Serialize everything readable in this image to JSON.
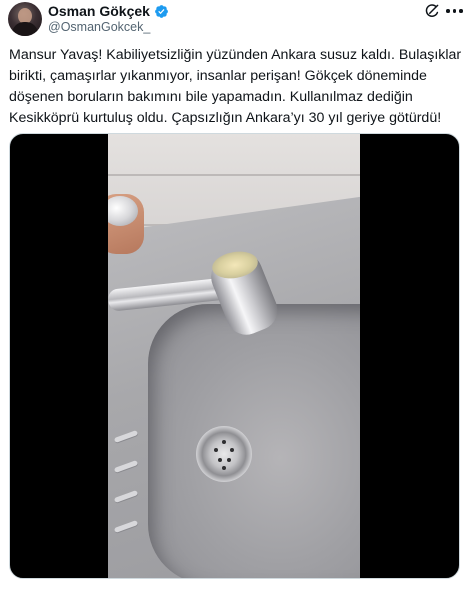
{
  "author": {
    "display_name": "Osman Gökçek",
    "handle": "@OsmanGokcek_",
    "verified_color": "#1d9bf0"
  },
  "actions": {
    "grok_icon": "grok-icon",
    "more_icon": "more-icon"
  },
  "tweet": {
    "text": "Mansur Yavaş! Kabiliyetsizliğin yüzünden Ankara susuz kaldı. Bulaşıklar birikti, çamaşırlar yıkanmıyor, insanlar perişan! Gökçek döneminde döşenen boruların bakımını bile yapamadın. Kullanılmaz dediğin Kesikköprü kurtuluş oldu. Çapsızlığın Ankara’yı 30 yıl geriye götürdü!"
  },
  "media": {
    "type": "video",
    "subject": "kitchen sink with faucet and drain"
  }
}
